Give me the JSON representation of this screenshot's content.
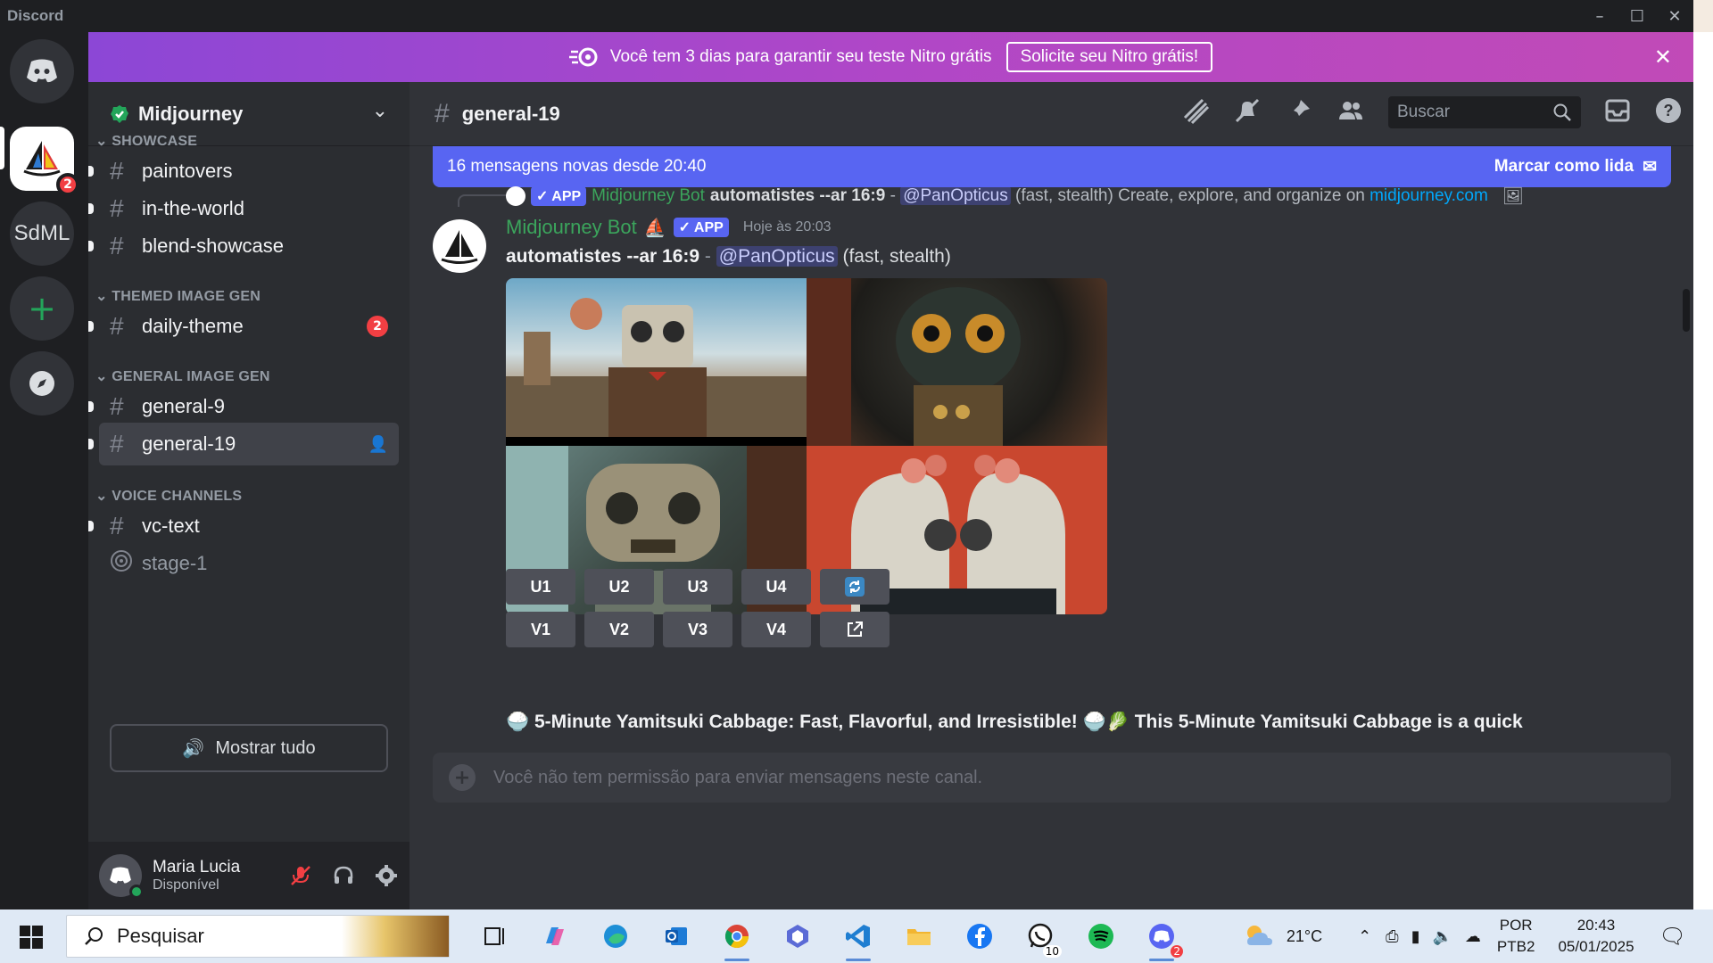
{
  "window": {
    "app_title": "Discord"
  },
  "servers": {
    "badge": "2",
    "sdml_label": "SdML"
  },
  "nitro": {
    "message": "Você tem 3 dias para garantir seu teste Nitro grátis",
    "cta": "Solicite seu Nitro grátis!"
  },
  "sidebar": {
    "guild_name": "Midjourney",
    "categories": [
      "SHOWCASE",
      "THEMED IMAGE GEN",
      "GENERAL IMAGE GEN",
      "VOICE CHANNELS"
    ],
    "channels": [
      {
        "name": "paintovers"
      },
      {
        "name": "in-the-world"
      },
      {
        "name": "blend-showcase"
      },
      {
        "name": "daily-theme",
        "badge": "2"
      },
      {
        "name": "general-9"
      },
      {
        "name": "general-19"
      },
      {
        "name": "vc-text"
      },
      {
        "name": "stage-1"
      }
    ],
    "show_all": "Mostrar tudo"
  },
  "user": {
    "name": "Maria Lucia",
    "status": "Disponível"
  },
  "chat": {
    "channel_title": "general-19",
    "search_placeholder": "Buscar",
    "new_messages": "16 mensagens novas desde 20:40",
    "mark_read": "Marcar como lida",
    "reply": {
      "app_tag": "APP",
      "author": "Midjourney Bot",
      "prompt": "automatistes --ar 16:9",
      "sep": " - ",
      "mention": "@PanOpticus",
      "tail": " (fast, stealth) Create, explore, and organize on ",
      "link": "midjourney.com"
    },
    "message": {
      "author": "Midjourney Bot",
      "app_tag": "APP",
      "time": "Hoje às 20:03",
      "prompt": "automatistes --ar 16:9",
      "sep": " - ",
      "mention": "@PanOpticus",
      "tail": " (fast, stealth)"
    },
    "buttons_u": [
      "U1",
      "U2",
      "U3",
      "U4"
    ],
    "buttons_v": [
      "V1",
      "V2",
      "V3",
      "V4"
    ],
    "next_message": "5-Minute Yamitsuki Cabbage: Fast, Flavorful, and Irresistible!",
    "next_message_tail": "This 5-Minute Yamitsuki Cabbage is a quick",
    "composer_placeholder": "Você não tem permissão para enviar mensagens neste canal."
  },
  "taskbar": {
    "search": "Pesquisar",
    "whatsapp_count": "10",
    "discord_count": "2",
    "weather": "21°C",
    "lang1": "POR",
    "lang2": "PTB2",
    "time": "20:43",
    "date": "05/01/2025"
  },
  "colors": {
    "blurple": "#5865f2",
    "green": "#23a55a",
    "red": "#f23f43",
    "bot_green": "#3ba55c"
  }
}
